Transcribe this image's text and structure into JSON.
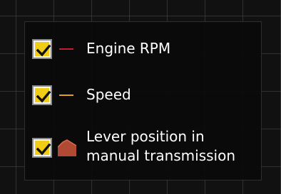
{
  "legend": {
    "items": [
      {
        "label": "Engine RPM",
        "checked": true,
        "swatch": "line",
        "color": "#c0202e"
      },
      {
        "label": "Speed",
        "checked": true,
        "swatch": "line",
        "color": "#e0a020"
      },
      {
        "label_line1": "Lever position in",
        "label_line2": "manual transmission",
        "checked": true,
        "swatch": "area",
        "color": "#b04a35",
        "edge_color": "#d96a4a"
      }
    ],
    "checkbox_fill_color": "#f2cd18",
    "checkmark_color": "#111111",
    "text_color": "#ffffff",
    "grid_color": "#4b4b4b"
  }
}
